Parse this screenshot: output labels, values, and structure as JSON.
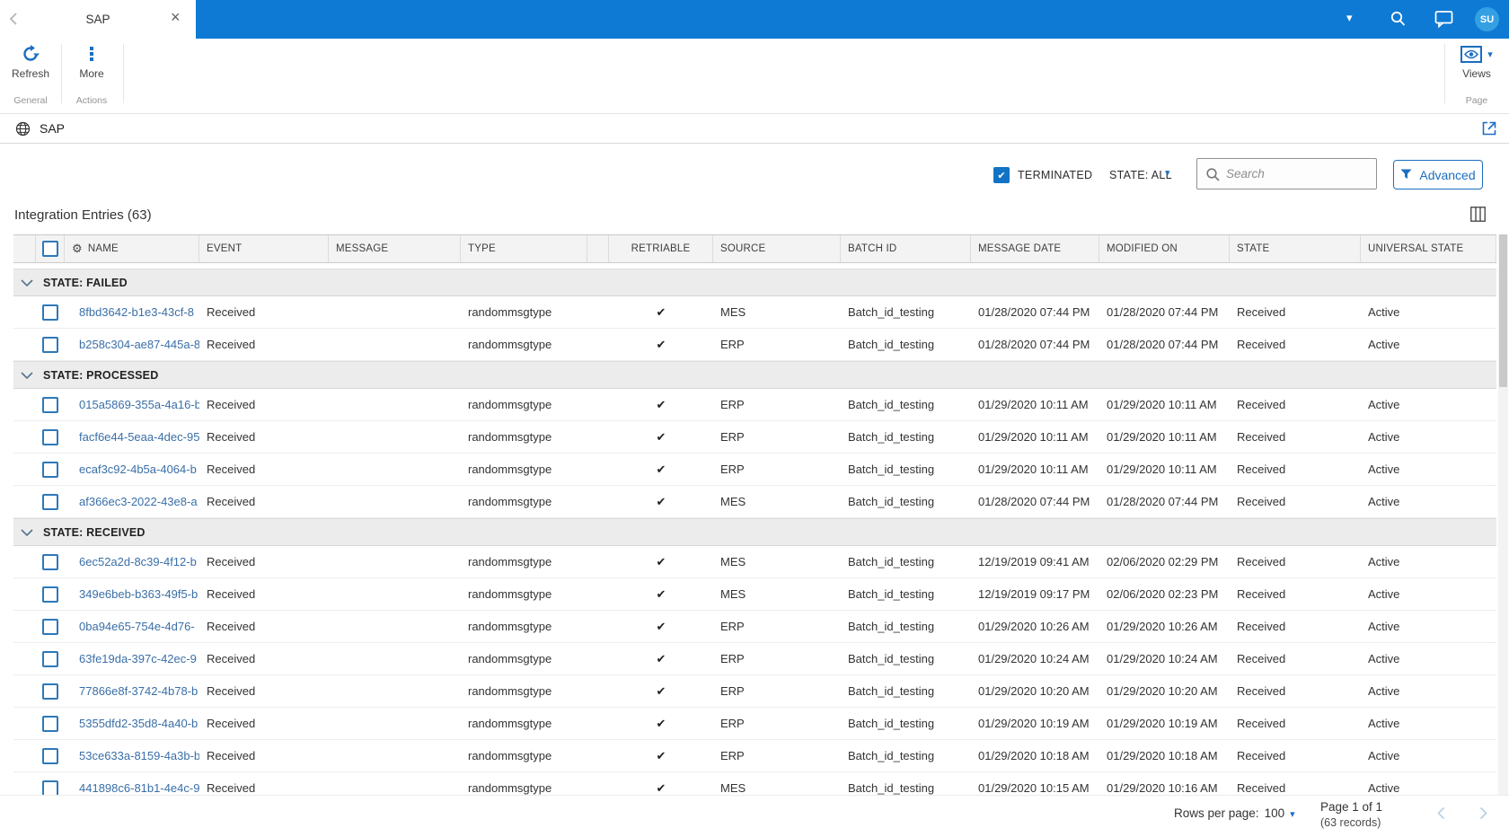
{
  "icons": {
    "close": "×",
    "caret_down": "▾",
    "gear": "⚙",
    "check": "✔"
  },
  "window_tab": {
    "title": "SAP"
  },
  "topbar": {
    "avatar_initials": "SU"
  },
  "ribbon": {
    "refresh_label": "Refresh",
    "general_caption": "General",
    "more_label": "More",
    "actions_caption": "Actions",
    "views_label": "Views",
    "page_caption": "Page"
  },
  "breadcrumb": {
    "title": "SAP"
  },
  "filters": {
    "terminated_label": "TERMINATED",
    "terminated_checked": true,
    "state_filter_label": "STATE: ALL",
    "search_placeholder": "Search",
    "advanced_label": "Advanced"
  },
  "list": {
    "title": "Integration Entries (63)",
    "columns": [
      "NAME",
      "EVENT",
      "MESSAGE",
      "TYPE",
      "RETRIABLE",
      "SOURCE",
      "BATCH ID",
      "MESSAGE DATE",
      "MODIFIED ON",
      "STATE",
      "UNIVERSAL STATE"
    ],
    "groups": [
      {
        "label": "STATE: FAILED",
        "rows": [
          {
            "name": "8fbd3642-b1e3-43cf-8",
            "event": "Received",
            "message": "",
            "type": "randommsgtype",
            "retriable": true,
            "source": "MES",
            "batch_id": "Batch_id_testing",
            "message_date": "01/28/2020 07:44 PM",
            "modified_on": "01/28/2020 07:44 PM",
            "state": "Received",
            "universal_state": "Active"
          },
          {
            "name": "b258c304-ae87-445a-8",
            "event": "Received",
            "message": "",
            "type": "randommsgtype",
            "retriable": true,
            "source": "ERP",
            "batch_id": "Batch_id_testing",
            "message_date": "01/28/2020 07:44 PM",
            "modified_on": "01/28/2020 07:44 PM",
            "state": "Received",
            "universal_state": "Active"
          }
        ]
      },
      {
        "label": "STATE: PROCESSED",
        "rows": [
          {
            "name": "015a5869-355a-4a16-b",
            "event": "Received",
            "message": "",
            "type": "randommsgtype",
            "retriable": true,
            "source": "ERP",
            "batch_id": "Batch_id_testing",
            "message_date": "01/29/2020 10:11 AM",
            "modified_on": "01/29/2020 10:11 AM",
            "state": "Received",
            "universal_state": "Active"
          },
          {
            "name": "facf6e44-5eaa-4dec-95",
            "event": "Received",
            "message": "",
            "type": "randommsgtype",
            "retriable": true,
            "source": "ERP",
            "batch_id": "Batch_id_testing",
            "message_date": "01/29/2020 10:11 AM",
            "modified_on": "01/29/2020 10:11 AM",
            "state": "Received",
            "universal_state": "Active"
          },
          {
            "name": "ecaf3c92-4b5a-4064-b",
            "event": "Received",
            "message": "",
            "type": "randommsgtype",
            "retriable": true,
            "source": "ERP",
            "batch_id": "Batch_id_testing",
            "message_date": "01/29/2020 10:11 AM",
            "modified_on": "01/29/2020 10:11 AM",
            "state": "Received",
            "universal_state": "Active"
          },
          {
            "name": "af366ec3-2022-43e8-a",
            "event": "Received",
            "message": "",
            "type": "randommsgtype",
            "retriable": true,
            "source": "MES",
            "batch_id": "Batch_id_testing",
            "message_date": "01/28/2020 07:44 PM",
            "modified_on": "01/28/2020 07:44 PM",
            "state": "Received",
            "universal_state": "Active"
          }
        ]
      },
      {
        "label": "STATE: RECEIVED",
        "rows": [
          {
            "name": "6ec52a2d-8c39-4f12-b",
            "event": "Received",
            "message": "",
            "type": "randommsgtype",
            "retriable": true,
            "source": "MES",
            "batch_id": "Batch_id_testing",
            "message_date": "12/19/2019 09:41 AM",
            "modified_on": "02/06/2020 02:29 PM",
            "state": "Received",
            "universal_state": "Active"
          },
          {
            "name": "349e6beb-b363-49f5-b",
            "event": "Received",
            "message": "",
            "type": "randommsgtype",
            "retriable": true,
            "source": "MES",
            "batch_id": "Batch_id_testing",
            "message_date": "12/19/2019 09:17 PM",
            "modified_on": "02/06/2020 02:23 PM",
            "state": "Received",
            "universal_state": "Active"
          },
          {
            "name": "0ba94e65-754e-4d76-",
            "event": "Received",
            "message": "",
            "type": "randommsgtype",
            "retriable": true,
            "source": "ERP",
            "batch_id": "Batch_id_testing",
            "message_date": "01/29/2020 10:26 AM",
            "modified_on": "01/29/2020 10:26 AM",
            "state": "Received",
            "universal_state": "Active"
          },
          {
            "name": "63fe19da-397c-42ec-9",
            "event": "Received",
            "message": "",
            "type": "randommsgtype",
            "retriable": true,
            "source": "ERP",
            "batch_id": "Batch_id_testing",
            "message_date": "01/29/2020 10:24 AM",
            "modified_on": "01/29/2020 10:24 AM",
            "state": "Received",
            "universal_state": "Active"
          },
          {
            "name": "77866e8f-3742-4b78-b",
            "event": "Received",
            "message": "",
            "type": "randommsgtype",
            "retriable": true,
            "source": "ERP",
            "batch_id": "Batch_id_testing",
            "message_date": "01/29/2020 10:20 AM",
            "modified_on": "01/29/2020 10:20 AM",
            "state": "Received",
            "universal_state": "Active"
          },
          {
            "name": "5355dfd2-35d8-4a40-b",
            "event": "Received",
            "message": "",
            "type": "randommsgtype",
            "retriable": true,
            "source": "ERP",
            "batch_id": "Batch_id_testing",
            "message_date": "01/29/2020 10:19 AM",
            "modified_on": "01/29/2020 10:19 AM",
            "state": "Received",
            "universal_state": "Active"
          },
          {
            "name": "53ce633a-8159-4a3b-b",
            "event": "Received",
            "message": "",
            "type": "randommsgtype",
            "retriable": true,
            "source": "ERP",
            "batch_id": "Batch_id_testing",
            "message_date": "01/29/2020 10:18 AM",
            "modified_on": "01/29/2020 10:18 AM",
            "state": "Received",
            "universal_state": "Active"
          },
          {
            "name": "441898c6-81b1-4e4c-9",
            "event": "Received",
            "message": "",
            "type": "randommsgtype",
            "retriable": true,
            "source": "MES",
            "batch_id": "Batch_id_testing",
            "message_date": "01/29/2020 10:15 AM",
            "modified_on": "01/29/2020 10:16 AM",
            "state": "Received",
            "universal_state": "Active"
          }
        ]
      }
    ]
  },
  "footer": {
    "rows_per_page_label": "Rows per page:",
    "rows_per_page_value": "100",
    "page_label": "Page 1 of 1",
    "records_label": "(63 records)"
  }
}
